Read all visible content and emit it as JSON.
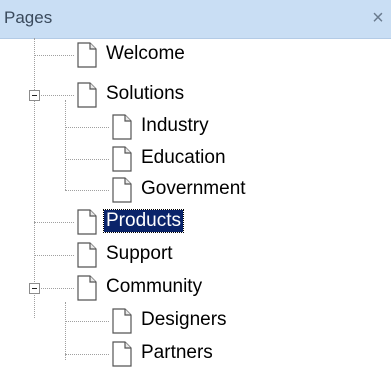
{
  "panel": {
    "title": "Pages",
    "close_glyph": "×"
  },
  "tree": {
    "selected": "Products",
    "nodes": [
      {
        "label": "Welcome",
        "level": 0,
        "expanded": null
      },
      {
        "label": "Solutions",
        "level": 0,
        "expanded": true
      },
      {
        "label": "Industry",
        "level": 1,
        "expanded": null
      },
      {
        "label": "Education",
        "level": 1,
        "expanded": null
      },
      {
        "label": "Government",
        "level": 1,
        "expanded": null
      },
      {
        "label": "Products",
        "level": 0,
        "expanded": null
      },
      {
        "label": "Support",
        "level": 0,
        "expanded": null
      },
      {
        "label": "Community",
        "level": 0,
        "expanded": true
      },
      {
        "label": "Designers",
        "level": 1,
        "expanded": null
      },
      {
        "label": "Partners",
        "level": 1,
        "expanded": null
      }
    ]
  },
  "icons": {
    "page": "page-icon",
    "collapse": "collapse-icon"
  },
  "colors": {
    "header_bg": "#c9def4",
    "selection_bg": "#0a246a",
    "selection_text": "#ffffff"
  }
}
